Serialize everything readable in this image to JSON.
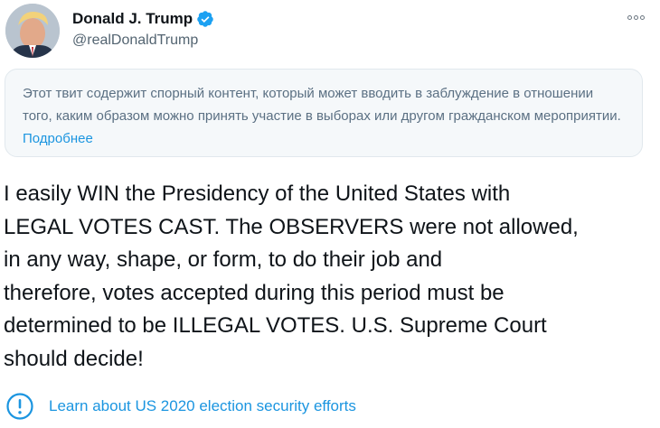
{
  "author": {
    "display_name": "Donald J. Trump",
    "handle": "@realDonaldTrump",
    "verified_icon": "verified-badge-icon",
    "avatar_icon": "profile-photo"
  },
  "more_icon": "more-options-icon",
  "notice": {
    "text": "Этот твит содержит спорный контент, который может вводить в заблуждение в отношении того, каким образом можно принять участие в выборах или другом гражданском мероприятии.",
    "link_label": "Подробнее"
  },
  "tweet": {
    "text": "I easily WIN the Presidency of the United States with\nLEGAL VOTES CAST. The OBSERVERS were not allowed,\nin any way, shape, or form, to do their job and\ntherefore, votes accepted during this period must be\ndetermined to be ILLEGAL VOTES. U.S. Supreme Court\nshould decide!"
  },
  "election_notice": {
    "icon": "exclamation-circle-icon",
    "label": "Learn about US 2020 election security efforts"
  },
  "colors": {
    "link": "#1b95e0",
    "verified": "#1da1f2",
    "notice_bg": "#f5f8fa",
    "notice_text": "#5b7083"
  }
}
